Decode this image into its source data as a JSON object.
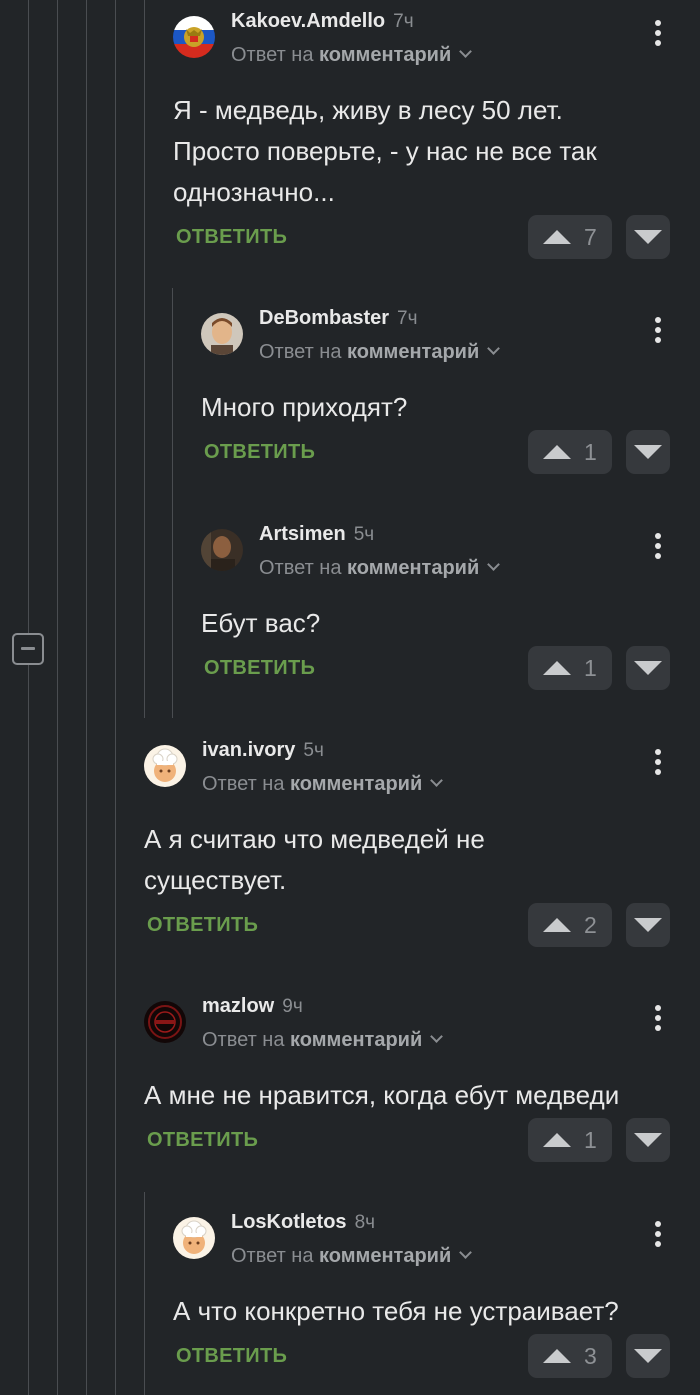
{
  "ui": {
    "reply_prefix": "Ответ на",
    "reply_target": "комментарий",
    "reply_button": "ОТВЕТИТЬ"
  },
  "colors": {
    "background": "#222528",
    "reply_green": "#6a9d4d",
    "vote_bg": "#36393d",
    "muted": "#8a8d91"
  },
  "comments": [
    {
      "username": "Kakoev.Amdello",
      "time": "7ч",
      "text": "Я - медведь, живу в лесу 50 лет.\nПросто поверьте, - у нас не все так\nоднозначно...",
      "votes": "7",
      "avatar_icon": "coat-of-arms-avatar"
    },
    {
      "username": "DeBombaster",
      "time": "7ч",
      "text": "Много приходят?",
      "votes": "1",
      "avatar_icon": "cartoon-man-avatar"
    },
    {
      "username": "Artsimen",
      "time": "5ч",
      "text": "Ебут вас?",
      "votes": "1",
      "avatar_icon": "photo-avatar"
    },
    {
      "username": "ivan.ivory",
      "time": "5ч",
      "text": "А я считаю что медведей не\nсуществует.",
      "votes": "2",
      "avatar_icon": "chef-avatar"
    },
    {
      "username": "mazlow",
      "time": "9ч",
      "text": "А мне не нравится, когда ебут медведи",
      "votes": "1",
      "avatar_icon": "dark-emblem-avatar"
    },
    {
      "username": "LosKotletos",
      "time": "8ч",
      "text": "А что конкретно тебя не устраивает?",
      "votes": "3",
      "avatar_icon": "chef-avatar"
    }
  ]
}
